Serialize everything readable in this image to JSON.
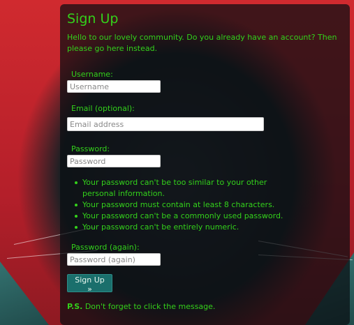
{
  "page": {
    "title": "Sign Up",
    "intro_text": "Hello to our lovely community. Do you already have an account? Then please ",
    "intro_link": "go here",
    "intro_tail": " instead."
  },
  "form": {
    "username": {
      "label": "Username:",
      "placeholder": "Username"
    },
    "email": {
      "label": "Email (optional):",
      "placeholder": "Email address"
    },
    "password": {
      "label": "Password:",
      "placeholder": "Password"
    },
    "password_rules": [
      "Your password can't be too similar to your other personal information.",
      "Your password must contain at least 8 characters.",
      "Your password can't be a commonly used password.",
      "Your password can't be entirely numeric."
    ],
    "password_again": {
      "label": "Password (again):",
      "placeholder": "Password (again)"
    },
    "submit_label": "Sign Up »"
  },
  "footer": {
    "ps_prefix": "P.S.",
    "ps_text": " Don't forget to click the message."
  },
  "colors": {
    "accent_green": "#33d11b",
    "button_teal": "#1a6f6c",
    "background_red": "#c8282e"
  }
}
